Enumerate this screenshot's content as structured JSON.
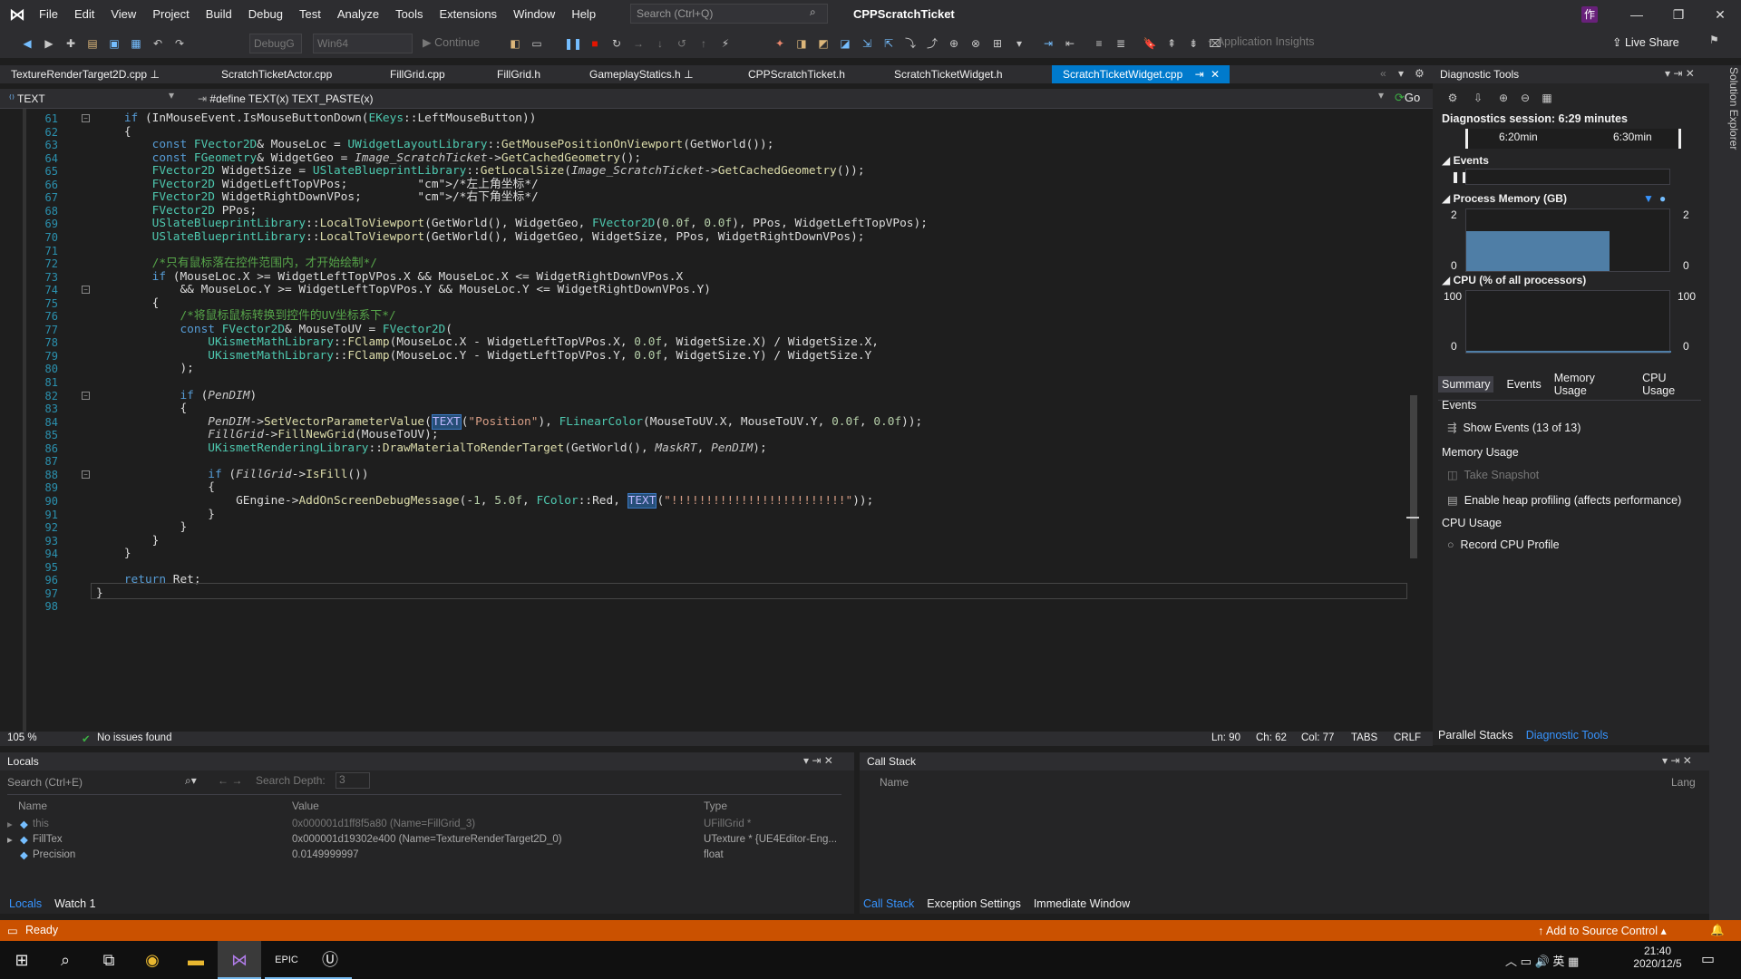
{
  "menu": [
    "File",
    "Edit",
    "View",
    "Project",
    "Build",
    "Debug",
    "Test",
    "Analyze",
    "Tools",
    "Extensions",
    "Window",
    "Help"
  ],
  "search": {
    "placeholder": "Search (Ctrl+Q)"
  },
  "window_title": "CPPScratchTicket",
  "user_badge": "作",
  "toolbar": {
    "config": "DebugG",
    "platform": "Win64",
    "continue": "Continue",
    "app_insights": "Application Insights",
    "live_share": "Live Share"
  },
  "tabs": [
    "TextureRenderTarget2D.cpp",
    "ScratchTicketActor.cpp",
    "FillGrid.cpp",
    "FillGrid.h",
    "GameplayStatics.h",
    "CPPScratchTicket.h",
    "ScratchTicketWidget.h",
    "ScratchTicketWidget.cpp"
  ],
  "navbar": {
    "scope": "TEXT",
    "define": "#define TEXT(x) TEXT_PASTE(x)",
    "go": "Go"
  },
  "status_line": {
    "zoom": "105 %",
    "issues": "No issues found",
    "ln": "Ln: 90",
    "ch": "Ch: 62",
    "col": "Col: 77",
    "tabs": "TABS",
    "crlf": "CRLF"
  },
  "diagnostics": {
    "title": "Diagnostic Tools",
    "session": "Diagnostics session: 6:29 minutes",
    "timeline": [
      "6:20min",
      "6:30min"
    ],
    "events_label": "Events",
    "memory_label": "Process Memory (GB)",
    "memory_max": "2",
    "memory_min": "0",
    "cpu_label": "CPU (% of all processors)",
    "cpu_max": "100",
    "cpu_min": "0",
    "tabs": [
      "Summary",
      "Events",
      "Memory Usage",
      "CPU Usage"
    ],
    "sec_events": "Events",
    "show_events": "Show Events (13 of 13)",
    "sec_memory": "Memory Usage",
    "take_snapshot": "Take Snapshot",
    "heap": "Enable heap profiling (affects performance)",
    "sec_cpu": "CPU Usage",
    "record_cpu": "Record CPU Profile",
    "bottom_tabs": [
      "Parallel Stacks",
      "Diagnostic Tools"
    ]
  },
  "locals": {
    "title": "Locals",
    "search": "Search (Ctrl+E)",
    "depth_label": "Search Depth:",
    "depth": "3",
    "cols": [
      "Name",
      "Value",
      "Type"
    ],
    "rows": [
      {
        "name": "this",
        "value": "0x000001d1ff8f5a80 (Name=FillGrid_3)",
        "type": "UFillGrid *"
      },
      {
        "name": "FillTex",
        "value": "0x000001d19302e400 (Name=TextureRenderTarget2D_0)",
        "type": "UTexture * {UE4Editor-Eng..."
      },
      {
        "name": "Precision",
        "value": "0.0149999997",
        "type": "float"
      }
    ],
    "tabs": [
      "Locals",
      "Watch 1"
    ]
  },
  "callstack": {
    "title": "Call Stack",
    "col_name": "Name",
    "col_lang": "Lang",
    "tabs": [
      "Call Stack",
      "Exception Settings",
      "Immediate Window"
    ]
  },
  "statusbar": {
    "ready": "Ready",
    "source": "Add to Source Control"
  },
  "taskbar": {
    "time": "21:40",
    "date": "2020/12/5",
    "ime": "英"
  },
  "code": [
    {
      "n": "61",
      "t": "    if (InMouseEvent.IsMouseButtonDown(EKeys::LeftMouseButton))"
    },
    {
      "n": "62",
      "t": "    {"
    },
    {
      "n": "63",
      "t": "        const FVector2D& MouseLoc = UWidgetLayoutLibrary::GetMousePositionOnViewport(GetWorld());"
    },
    {
      "n": "64",
      "t": "        const FGeometry& WidgetGeo = Image_ScratchTicket->GetCachedGeometry();"
    },
    {
      "n": "65",
      "t": "        FVector2D WidgetSize = USlateBlueprintLibrary::GetLocalSize(Image_ScratchTicket->GetCachedGeometry());"
    },
    {
      "n": "66",
      "t": "        FVector2D WidgetLeftTopVPos;          /*左上角坐标*/"
    },
    {
      "n": "67",
      "t": "        FVector2D WidgetRightDownVPos;        /*右下角坐标*/"
    },
    {
      "n": "68",
      "t": "        FVector2D PPos;"
    },
    {
      "n": "69",
      "t": "        USlateBlueprintLibrary::LocalToViewport(GetWorld(), WidgetGeo, FVector2D(0.0f, 0.0f), PPos, WidgetLeftTopVPos);"
    },
    {
      "n": "70",
      "t": "        USlateBlueprintLibrary::LocalToViewport(GetWorld(), WidgetGeo, WidgetSize, PPos, WidgetRightDownVPos);"
    },
    {
      "n": "71",
      "t": ""
    },
    {
      "n": "72",
      "t": "        /*只有鼠标落在控件范围内，才开始绘制*/"
    },
    {
      "n": "73",
      "t": "        if (MouseLoc.X >= WidgetLeftTopVPos.X && MouseLoc.X <= WidgetRightDownVPos.X"
    },
    {
      "n": "74",
      "t": "            && MouseLoc.Y >= WidgetLeftTopVPos.Y && MouseLoc.Y <= WidgetRightDownVPos.Y)"
    },
    {
      "n": "75",
      "t": "        {"
    },
    {
      "n": "76",
      "t": "            /*将鼠标鼠标转换到控件的UV坐标系下*/"
    },
    {
      "n": "77",
      "t": "            const FVector2D& MouseToUV = FVector2D("
    },
    {
      "n": "78",
      "t": "                UKismetMathLibrary::FClamp(MouseLoc.X - WidgetLeftTopVPos.X, 0.0f, WidgetSize.X) / WidgetSize.X,"
    },
    {
      "n": "79",
      "t": "                UKismetMathLibrary::FClamp(MouseLoc.Y - WidgetLeftTopVPos.Y, 0.0f, WidgetSize.Y) / WidgetSize.Y"
    },
    {
      "n": "80",
      "t": "            );"
    },
    {
      "n": "81",
      "t": ""
    },
    {
      "n": "82",
      "t": "            if (PenDIM)"
    },
    {
      "n": "83",
      "t": "            {"
    },
    {
      "n": "84",
      "t": "                PenDIM->SetVectorParameterValue(TEXT(\"Position\"), FLinearColor(MouseToUV.X, MouseToUV.Y, 0.0f, 0.0f));"
    },
    {
      "n": "85",
      "t": "                FillGrid->FillNewGrid(MouseToUV);"
    },
    {
      "n": "86",
      "t": "                UKismetRenderingLibrary::DrawMaterialToRenderTarget(GetWorld(), MaskRT, PenDIM);"
    },
    {
      "n": "87",
      "t": ""
    },
    {
      "n": "88",
      "t": "                if (FillGrid->IsFill())"
    },
    {
      "n": "89",
      "t": "                {"
    },
    {
      "n": "90",
      "t": "                    GEngine->AddOnScreenDebugMessage(-1, 5.0f, FColor::Red, TEXT(\"!!!!!!!!!!!!!!!!!!!!!!!!!\"));"
    },
    {
      "n": "91",
      "t": "                }"
    },
    {
      "n": "92",
      "t": "            }"
    },
    {
      "n": "93",
      "t": "        }"
    },
    {
      "n": "94",
      "t": "    }"
    },
    {
      "n": "95",
      "t": ""
    },
    {
      "n": "96",
      "t": "    return Ret;"
    },
    {
      "n": "97",
      "t": "}"
    },
    {
      "n": "98",
      "t": ""
    }
  ],
  "colors": {
    "accent": "#007acc",
    "status": "#ca5100",
    "bg": "#1e1e1e",
    "panel": "#252526"
  }
}
